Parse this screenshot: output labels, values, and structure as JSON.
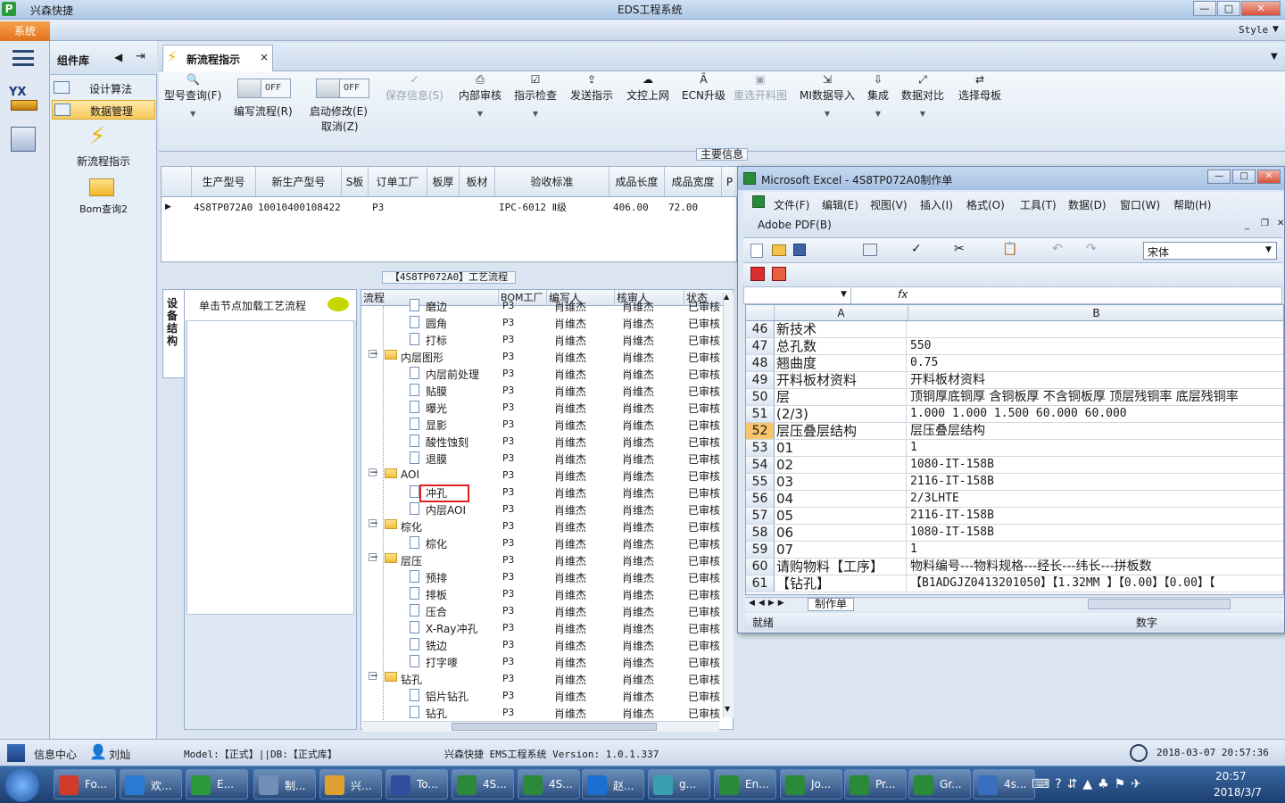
{
  "window": {
    "app_name": "兴森快捷",
    "title": "EDS工程系统",
    "logo": "P",
    "min": "—",
    "max": "□",
    "close": "✕"
  },
  "menubar": {
    "system": "系统",
    "style": "Style"
  },
  "component_library": {
    "title": "组件库",
    "items": [
      {
        "label": "设计算法"
      },
      {
        "label": "数据管理",
        "selected": true
      }
    ],
    "tiles": [
      {
        "label": "新流程指示"
      },
      {
        "label": "Bom查询2"
      }
    ]
  },
  "tab": {
    "label": "新流程指示",
    "close": "×"
  },
  "ribbon": {
    "buttons": [
      {
        "label": "型号查询(F)",
        "enabled": true
      },
      {
        "label": "编写流程(R)",
        "enabled": true,
        "toggle": "OFF"
      },
      {
        "label": "启动修改(E)",
        "label2": "取消(Z)",
        "enabled": true,
        "toggle": "OFF"
      },
      {
        "label": "保存信息(S)",
        "enabled": false
      },
      {
        "label": "内部审核",
        "enabled": true
      },
      {
        "label": "指示检查",
        "enabled": true
      },
      {
        "label": "发送指示",
        "enabled": true
      },
      {
        "label": "文控上网",
        "enabled": true
      },
      {
        "label": "ECN升级",
        "enabled": true
      },
      {
        "label": "重选开料图",
        "enabled": false
      },
      {
        "label": "MI数据导入",
        "enabled": true
      },
      {
        "label": "集成",
        "enabled": true
      },
      {
        "label": "数据对比",
        "enabled": true
      },
      {
        "label": "选择母板",
        "enabled": true
      }
    ]
  },
  "main_info": {
    "header": "主要信息",
    "columns": [
      "生产型号",
      "新生产型号",
      "S板",
      "订单工厂",
      "板厚",
      "板材",
      "验收标准",
      "成品长度",
      "成品宽度",
      "P"
    ],
    "row": [
      "4S8TP072A0",
      "10010400108422",
      "",
      "P3",
      "",
      "",
      "IPC-6012 Ⅱ级",
      "406.00",
      "72.00",
      ""
    ]
  },
  "process": {
    "header": "【4S8TP072A0】工艺流程",
    "side_tab": "设备结构",
    "hint": "单击节点加载工艺流程",
    "columns": [
      "流程",
      "BOM工厂",
      "编写人",
      "核审人",
      "状态"
    ],
    "rows": [
      {
        "name": "磨边",
        "type": "doc",
        "level": 2,
        "factory": "P3",
        "writer": "肖维杰",
        "reviewer": "肖维杰",
        "status": "已审核"
      },
      {
        "name": "圆角",
        "type": "doc",
        "level": 2,
        "factory": "P3",
        "writer": "肖维杰",
        "reviewer": "肖维杰",
        "status": "已审核"
      },
      {
        "name": "打标",
        "type": "doc",
        "level": 2,
        "factory": "P3",
        "writer": "肖维杰",
        "reviewer": "肖维杰",
        "status": "已审核"
      },
      {
        "name": "内层图形",
        "type": "folder",
        "level": 1,
        "factory": "P3",
        "writer": "肖维杰",
        "reviewer": "肖维杰",
        "status": "已审核"
      },
      {
        "name": "内层前处理",
        "type": "doc",
        "level": 2,
        "factory": "P3",
        "writer": "肖维杰",
        "reviewer": "肖维杰",
        "status": "已审核"
      },
      {
        "name": "贴膜",
        "type": "doc",
        "level": 2,
        "factory": "P3",
        "writer": "肖维杰",
        "reviewer": "肖维杰",
        "status": "已审核"
      },
      {
        "name": "曝光",
        "type": "doc",
        "level": 2,
        "factory": "P3",
        "writer": "肖维杰",
        "reviewer": "肖维杰",
        "status": "已审核"
      },
      {
        "name": "显影",
        "type": "doc",
        "level": 2,
        "factory": "P3",
        "writer": "肖维杰",
        "reviewer": "肖维杰",
        "status": "已审核"
      },
      {
        "name": "酸性蚀刻",
        "type": "doc",
        "level": 2,
        "factory": "P3",
        "writer": "肖维杰",
        "reviewer": "肖维杰",
        "status": "已审核"
      },
      {
        "name": "退膜",
        "type": "doc",
        "level": 2,
        "factory": "P3",
        "writer": "肖维杰",
        "reviewer": "肖维杰",
        "status": "已审核"
      },
      {
        "name": "AOI",
        "type": "folder",
        "level": 1,
        "factory": "P3",
        "writer": "肖维杰",
        "reviewer": "肖维杰",
        "status": "已审核"
      },
      {
        "name": "冲孔",
        "type": "doc",
        "level": 2,
        "factory": "P3",
        "writer": "肖维杰",
        "reviewer": "肖维杰",
        "status": "已审核"
      },
      {
        "name": "内层AOI",
        "type": "doc",
        "level": 2,
        "factory": "P3",
        "writer": "肖维杰",
        "reviewer": "肖维杰",
        "status": "已审核"
      },
      {
        "name": "棕化",
        "type": "folder",
        "level": 1,
        "factory": "P3",
        "writer": "肖维杰",
        "reviewer": "肖维杰",
        "status": "已审核"
      },
      {
        "name": "棕化",
        "type": "doc",
        "level": 2,
        "factory": "P3",
        "writer": "肖维杰",
        "reviewer": "肖维杰",
        "status": "已审核"
      },
      {
        "name": "层压",
        "type": "folder",
        "level": 1,
        "factory": "P3",
        "writer": "肖维杰",
        "reviewer": "肖维杰",
        "status": "已审核"
      },
      {
        "name": "预排",
        "type": "doc",
        "level": 2,
        "factory": "P3",
        "writer": "肖维杰",
        "reviewer": "肖维杰",
        "status": "已审核"
      },
      {
        "name": "排板",
        "type": "doc",
        "level": 2,
        "factory": "P3",
        "writer": "肖维杰",
        "reviewer": "肖维杰",
        "status": "已审核"
      },
      {
        "name": "压合",
        "type": "doc",
        "level": 2,
        "factory": "P3",
        "writer": "肖维杰",
        "reviewer": "肖维杰",
        "status": "已审核"
      },
      {
        "name": "X-Ray冲孔",
        "type": "doc",
        "level": 2,
        "factory": "P3",
        "writer": "肖维杰",
        "reviewer": "肖维杰",
        "status": "已审核"
      },
      {
        "name": "铣边",
        "type": "doc",
        "level": 2,
        "factory": "P3",
        "writer": "肖维杰",
        "reviewer": "肖维杰",
        "status": "已审核"
      },
      {
        "name": "打字嘜",
        "type": "doc",
        "level": 2,
        "factory": "P3",
        "writer": "肖维杰",
        "reviewer": "肖维杰",
        "status": "已审核"
      },
      {
        "name": "钻孔",
        "type": "folder",
        "level": 1,
        "factory": "P3",
        "writer": "肖维杰",
        "reviewer": "肖维杰",
        "status": "已审核"
      },
      {
        "name": "铝片钻孔",
        "type": "doc",
        "level": 2,
        "factory": "P3",
        "writer": "肖维杰",
        "reviewer": "肖维杰",
        "status": "已审核"
      },
      {
        "name": "钻孔",
        "type": "doc",
        "level": 2,
        "factory": "P3",
        "writer": "肖维杰",
        "reviewer": "肖维杰",
        "status": "已审核"
      }
    ]
  },
  "excel": {
    "title": "Microsoft Excel - 4S8TP072A0制作单",
    "menus": [
      "文件(F)",
      "编辑(E)",
      "视图(V)",
      "插入(I)",
      "格式(O)",
      "工具(T)",
      "数据(D)",
      "窗口(W)",
      "帮助(H)"
    ],
    "menu2": "Adobe PDF(B)",
    "font_name": "宋体",
    "fx": "fx",
    "col_a": "A",
    "col_b": "B",
    "rows": [
      {
        "n": "46",
        "a": "新技术",
        "b": ""
      },
      {
        "n": "47",
        "a": "总孔数",
        "b": "550"
      },
      {
        "n": "48",
        "a": "翘曲度",
        "b": "0.75"
      },
      {
        "n": "49",
        "a": "开料板材资料",
        "b": "开料板材资料"
      },
      {
        "n": "50",
        "a": "层",
        "b": "顶铜厚底铜厚 含铜板厚 不含铜板厚 顶层残铜率 底层残铜率"
      },
      {
        "n": "51",
        "a": "(2/3)",
        "b": "1.000  1.000   1.500          60.000   60.000"
      },
      {
        "n": "52",
        "a": "层压叠层结构",
        "b": "层压叠层结构",
        "selected": true
      },
      {
        "n": "53",
        "a": "01",
        "b": "1"
      },
      {
        "n": "54",
        "a": "02",
        "b": "1080-IT-158B"
      },
      {
        "n": "55",
        "a": "03",
        "b": "2116-IT-158B"
      },
      {
        "n": "56",
        "a": "04",
        "b": "2/3LHTE"
      },
      {
        "n": "57",
        "a": "05",
        "b": "2116-IT-158B"
      },
      {
        "n": "58",
        "a": "06",
        "b": "1080-IT-158B"
      },
      {
        "n": "59",
        "a": "07",
        "b": "1"
      },
      {
        "n": "60",
        "a": "请购物料【工序】",
        "b": "物料编号---物料规格---经长---纬长---拼板数"
      },
      {
        "n": "61",
        "a": "【钻孔】",
        "b": "【B1ADGJZ0413201050】【1.32MM 】【0.00】【0.00】【"
      }
    ],
    "sheet_tab": "制作单",
    "status_left": "就绪",
    "status_right": "数字"
  },
  "statusbar": {
    "info_center": "信息中心",
    "user": "刘灿",
    "model": "Model:【正式】||DB:【正式库】",
    "version": "兴森快捷 EMS工程系统 Version: 1.0.1.337",
    "datetime": "2018-03-07 20:57:36"
  },
  "taskbar": {
    "tasks": [
      {
        "label": "Fo...",
        "color": "#d23a2a"
      },
      {
        "label": "欢...",
        "color": "#2a7ad2"
      },
      {
        "label": "E...",
        "color": "#2a9a3a"
      },
      {
        "label": "制...",
        "color": "#6f8fb8"
      },
      {
        "label": "兴...",
        "color": "#e0a030"
      },
      {
        "label": "To...",
        "color": "#304ea0"
      },
      {
        "label": "4S...",
        "color": "#2a8a3a"
      },
      {
        "label": "4S...",
        "color": "#2a8a3a"
      },
      {
        "label": "赵...",
        "color": "#1b6fd0"
      },
      {
        "label": "g...",
        "color": "#3aa0b0"
      },
      {
        "label": "En...",
        "color": "#2a8a3a"
      },
      {
        "label": "Jo...",
        "color": "#2a8a3a"
      },
      {
        "label": "Pr...",
        "color": "#2a8a3a"
      },
      {
        "label": "Gr...",
        "color": "#2a8a3a"
      },
      {
        "label": "4s...",
        "color": "#3a6fc0"
      }
    ],
    "clock_time": "20:57",
    "clock_date": "2018/3/7"
  }
}
